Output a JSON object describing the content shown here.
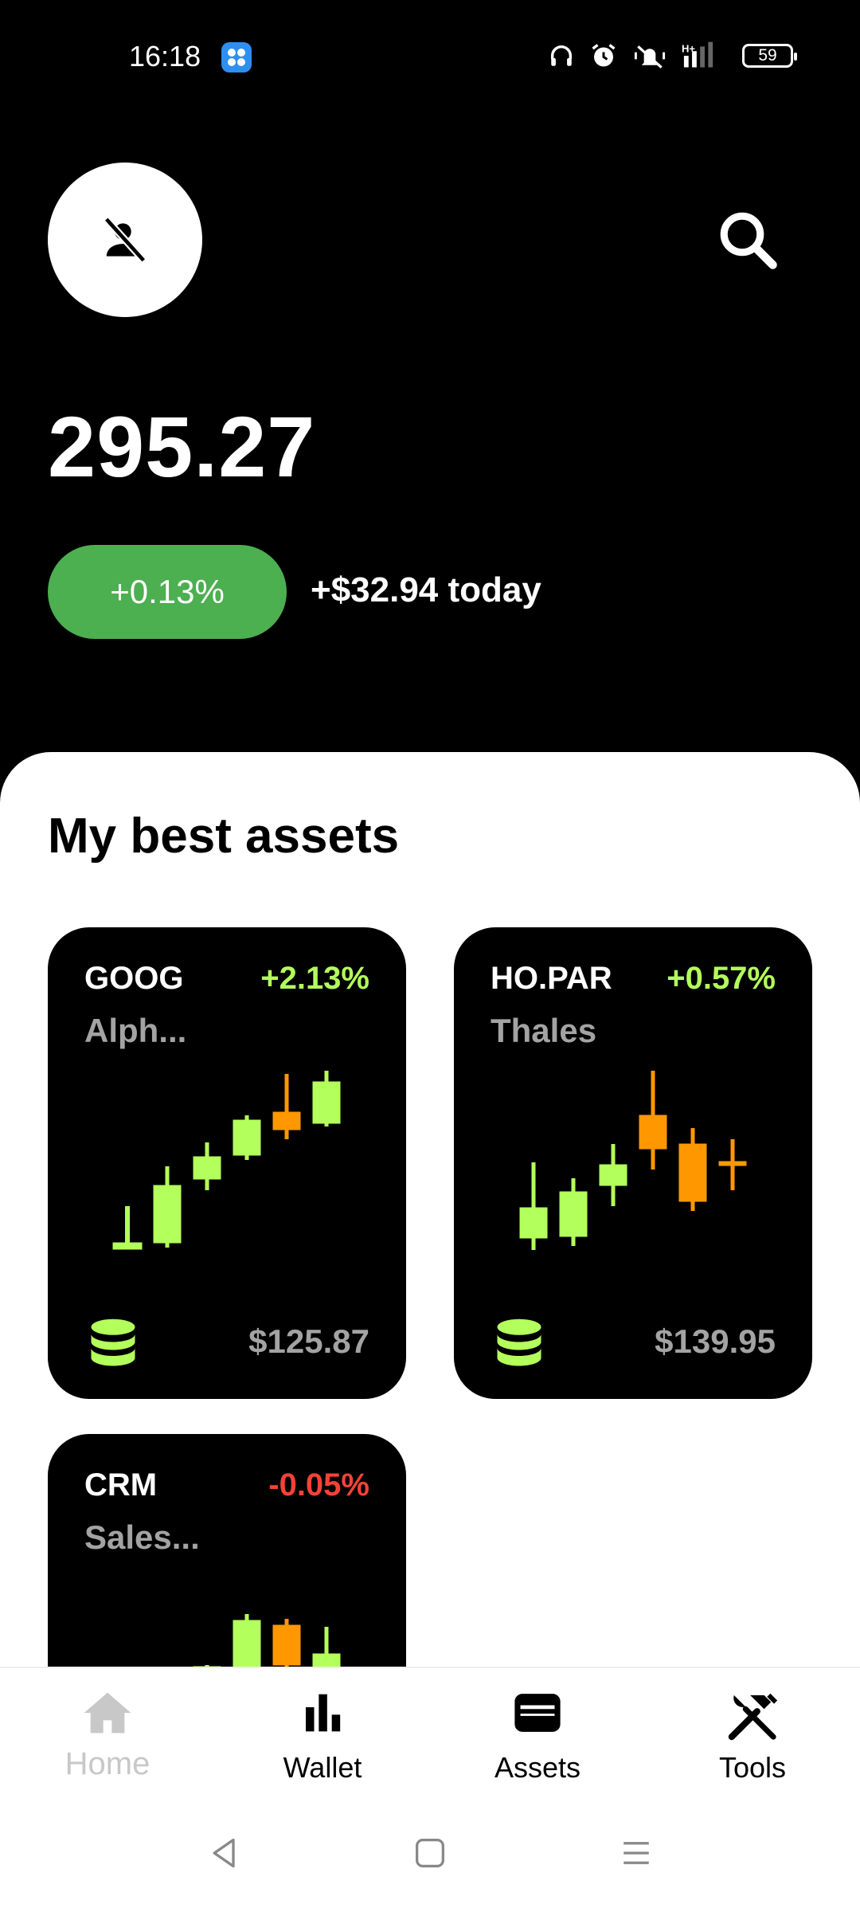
{
  "status_bar": {
    "time": "16:18",
    "battery": "59"
  },
  "header": {
    "balance": "295.27",
    "change_percent": "+0.13%",
    "change_today": "+$32.94 today"
  },
  "section": {
    "title": "My best assets"
  },
  "assets": [
    {
      "ticker": "GOOG",
      "name": "Alph...",
      "change": "+2.13%",
      "price": "$125.87",
      "trend": "up"
    },
    {
      "ticker": "HO.PAR",
      "name": "Thales",
      "change": "+0.57%",
      "price": "$139.95",
      "trend": "up"
    },
    {
      "ticker": "CRM",
      "name": "Sales...",
      "change": "-0.05%",
      "price": "",
      "trend": "down"
    }
  ],
  "colors": {
    "positive": "#b3ff5c",
    "negative": "#f44336",
    "candle_up": "#b3ff5c",
    "candle_down": "#ff9800",
    "pill": "#4caf50"
  },
  "nav": {
    "home": "Home",
    "wallet": "Wallet",
    "assets": "Assets",
    "tools": "Tools"
  },
  "icons": {
    "avatar": "person-off-icon",
    "search": "search-icon",
    "card_db": "database-icon",
    "home": "home-icon",
    "wallet": "bar-chart-icon",
    "assets": "wallet-icon",
    "tools": "tools-icon"
  }
}
